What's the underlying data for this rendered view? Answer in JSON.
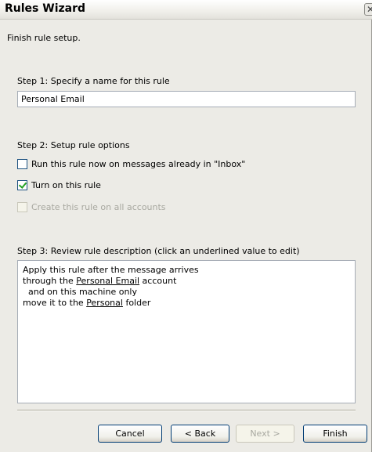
{
  "window": {
    "title": "Rules Wizard",
    "close_glyph": "✕"
  },
  "intro": "Finish rule setup.",
  "step1": {
    "label": "Step 1: Specify a name for this rule",
    "value": "Personal Email"
  },
  "step2": {
    "label": "Step 2: Setup rule options",
    "options": [
      {
        "label": "Run this rule now on messages already in \"Inbox\"",
        "checked": false,
        "enabled": true
      },
      {
        "label": "Turn on this rule",
        "checked": true,
        "enabled": true
      },
      {
        "label": "Create this rule on all accounts",
        "checked": false,
        "enabled": false
      }
    ]
  },
  "step3": {
    "label": "Step 3: Review rule description (click an underlined value to edit)",
    "lines": {
      "l1": "Apply this rule after the message arrives",
      "l2_pre": "through the ",
      "l2_link": "Personal Email",
      "l2_post": " account",
      "l3": "  and on this machine only",
      "l4_pre": "move it to the ",
      "l4_link": "Personal",
      "l4_post": " folder"
    }
  },
  "buttons": {
    "cancel": "Cancel",
    "back": "< Back",
    "next": "Next >",
    "finish": "Finish"
  }
}
